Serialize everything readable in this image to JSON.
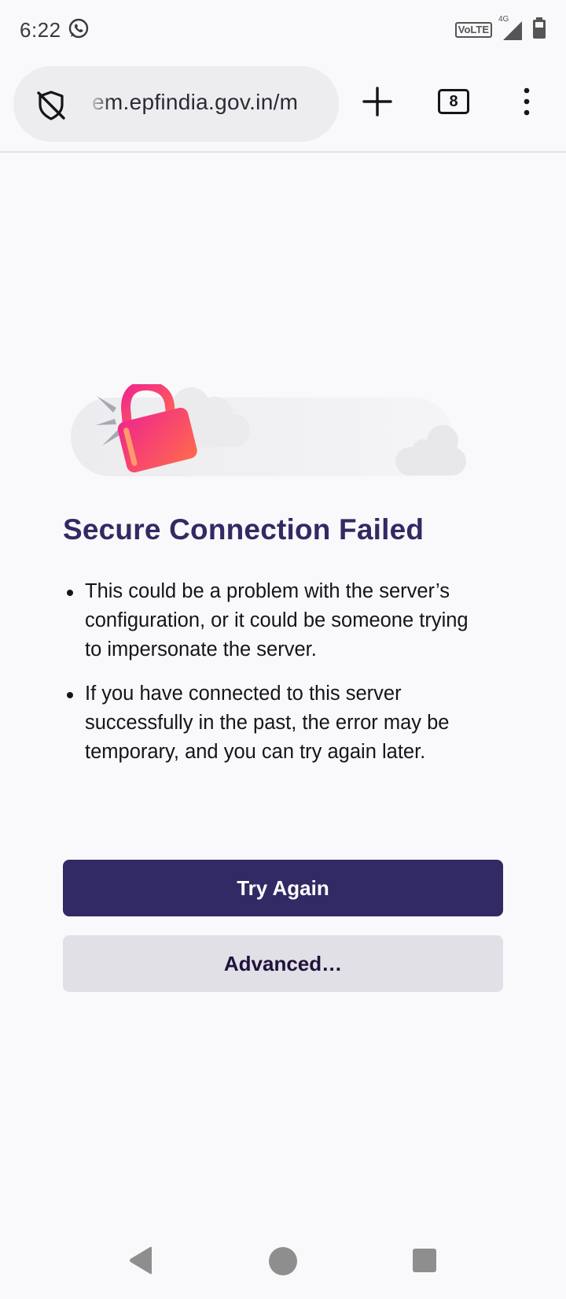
{
  "status_bar": {
    "time": "6:22",
    "volte": "VoLTE",
    "network": "4G",
    "icons": [
      "whatsapp-icon",
      "volte-icon",
      "signal-icon",
      "battery-icon"
    ]
  },
  "toolbar": {
    "url": "em.epfindia.gov.in/m",
    "tab_count": "8",
    "icons": [
      "shield-off-icon",
      "plus-icon",
      "tab-counter-icon",
      "more-vertical-icon"
    ]
  },
  "error": {
    "title": "Secure Connection Failed",
    "bullets": [
      "This could be a problem with the server’s configuration, or it could be someone trying to impersonate the server.",
      "If you have connected to this server successfully in the past, the error may be temporary, and you can try again later."
    ],
    "try_again_label": "Try Again",
    "advanced_label": "Advanced…"
  },
  "colors": {
    "accent": "#312a64",
    "background": "#f9f9fb",
    "secondary_button": "#e0e0e6",
    "lock_gradient_start": "#f0268c",
    "lock_gradient_end": "#ff6a4d"
  },
  "nav_bar": {
    "icons": [
      "back-icon",
      "home-icon",
      "recents-icon"
    ]
  }
}
